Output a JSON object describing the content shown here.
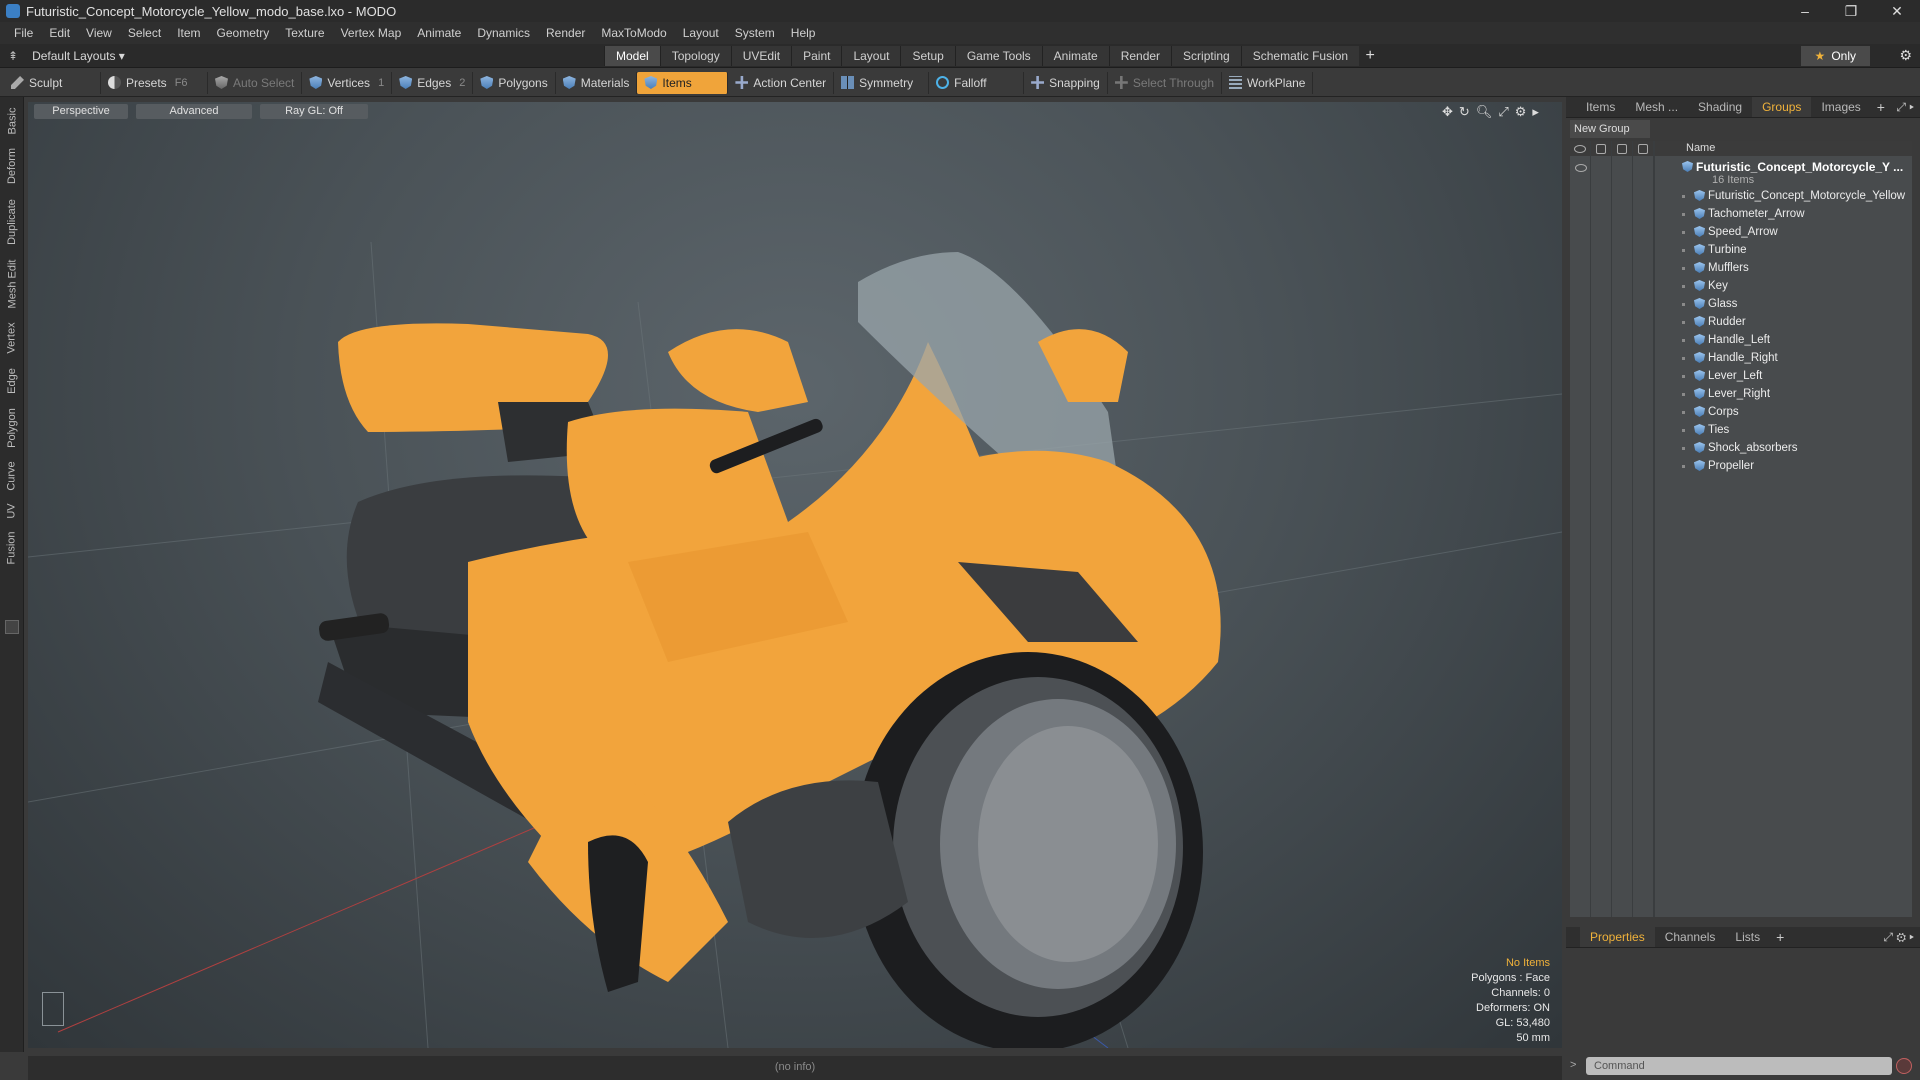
{
  "window": {
    "title": "Futuristic_Concept_Motorcycle_Yellow_modo_base.lxo - MODO",
    "minimize": "–",
    "maximize": "❐",
    "close": "✕"
  },
  "menu": [
    "File",
    "Edit",
    "View",
    "Select",
    "Item",
    "Geometry",
    "Texture",
    "Vertex Map",
    "Animate",
    "Dynamics",
    "Render",
    "MaxToModo",
    "Layout",
    "System",
    "Help"
  ],
  "layout": {
    "selector": "Default Layouts ▾",
    "tabs": [
      "Model",
      "Topology",
      "UVEdit",
      "Paint",
      "Layout",
      "Setup",
      "Game Tools",
      "Animate",
      "Render",
      "Scripting",
      "Schematic Fusion"
    ],
    "active_tab": "Model",
    "add": "+",
    "only": "Only"
  },
  "toolbar": {
    "sculpt": "Sculpt",
    "presets": "Presets",
    "presets_key": "F6",
    "auto_select": "Auto Select",
    "vertices": "Vertices",
    "vertices_num": "1",
    "edges": "Edges",
    "edges_num": "2",
    "polygons": "Polygons",
    "materials": "Materials",
    "items": "Items",
    "action_center": "Action Center",
    "symmetry": "Symmetry",
    "falloff": "Falloff",
    "snapping": "Snapping",
    "select_through": "Select Through",
    "workplane": "WorkPlane"
  },
  "left_tabs": [
    "Basic",
    "Deform",
    "Duplicate",
    "Mesh Edit",
    "Vertex",
    "Edge",
    "Polygon",
    "Curve",
    "UV",
    "Fusion"
  ],
  "viewport": {
    "view": "Perspective",
    "shading": "Advanced",
    "raygl": "Ray GL: Off",
    "info": {
      "selection": "No Items",
      "polygons": "Polygons : Face",
      "channels": "Channels: 0",
      "deformers": "Deformers: ON",
      "gl": "GL: 53,480",
      "focal": "50 mm"
    }
  },
  "status": "(no info)",
  "right_panel": {
    "tabs": [
      "Items",
      "Mesh ...",
      "Shading",
      "Groups",
      "Images"
    ],
    "active_tab": "Groups",
    "add": "+",
    "new_group": "New Group",
    "name_col": "Name",
    "group": {
      "name": "Futuristic_Concept_Motorcycle_Y ...",
      "count": "16 Items",
      "items": [
        "Futuristic_Concept_Motorcycle_Yellow",
        "Tachometer_Arrow",
        "Speed_Arrow",
        "Turbine",
        "Mufflers",
        "Key",
        "Glass",
        "Rudder",
        "Handle_Left",
        "Handle_Right",
        "Lever_Left",
        "Lever_Right",
        "Corps",
        "Ties",
        "Shock_absorbers",
        "Propeller"
      ]
    },
    "bottom_tabs": [
      "Properties",
      "Channels",
      "Lists"
    ],
    "bottom_active": "Properties",
    "command_placeholder": "Command"
  },
  "colors": {
    "accent": "#f0a43a",
    "bike_body": "#f2a43c",
    "viewport_bg": "#4a5257"
  }
}
